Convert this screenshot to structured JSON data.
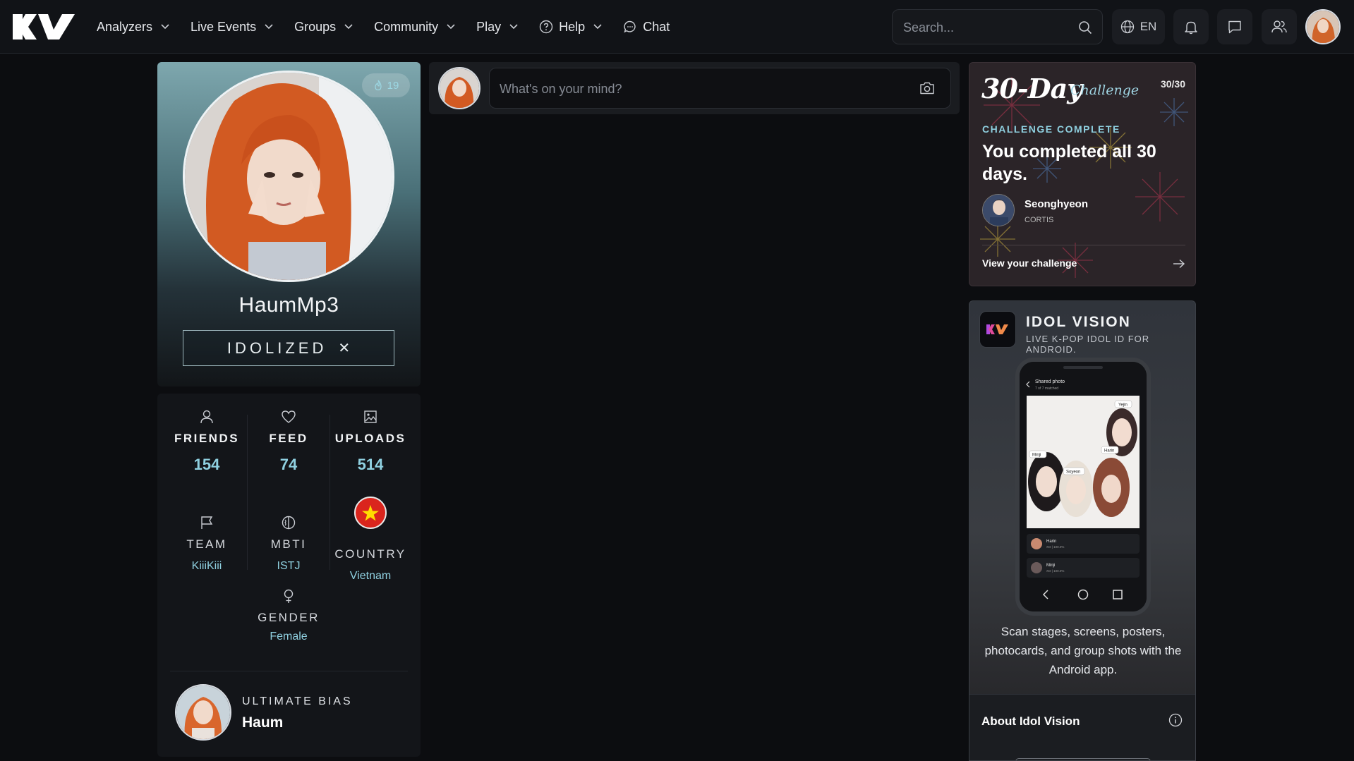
{
  "header": {
    "nav": [
      {
        "label": "Analyzers"
      },
      {
        "label": "Live Events"
      },
      {
        "label": "Groups"
      },
      {
        "label": "Community"
      },
      {
        "label": "Play"
      },
      {
        "label": "Help"
      },
      {
        "label": "Chat"
      }
    ],
    "search_placeholder": "Search...",
    "language": "EN"
  },
  "profile": {
    "badge_count": "19",
    "username": "HaumMp3",
    "idolized_label": "IDOLIZED",
    "idolized_close": "✕"
  },
  "stats": {
    "friends": {
      "label": "FRIENDS",
      "value": "154"
    },
    "feed": {
      "label": "FEED",
      "value": "74"
    },
    "uploads": {
      "label": "UPLOADS",
      "value": "514"
    },
    "team": {
      "label": "TEAM",
      "value": "KiiiKiii"
    },
    "mbti": {
      "label": "MBTI",
      "value": "ISTJ"
    },
    "country": {
      "label": "COUNTRY",
      "value": "Vietnam"
    },
    "gender": {
      "label": "GENDER",
      "value": "Female"
    },
    "bias_label": "ULTIMATE BIAS",
    "bias_name": "Haum"
  },
  "composer": {
    "placeholder": "What's on your mind?"
  },
  "challenge": {
    "title_main": "30-Day",
    "title_script": "Challenge",
    "count": "30/30",
    "status": "CHALLENGE COMPLETE",
    "message": "You completed all 30 days.",
    "user": "Seonghyeon",
    "group": "CORTIS",
    "link": "View your challenge"
  },
  "vision": {
    "title": "IDOL VISION",
    "subtitle": "LIVE K-POP IDOL ID FOR ANDROID.",
    "description": "Scan stages, screens, posters, photocards, and group shots with the Android app.",
    "about": "About Idol Vision",
    "phone": {
      "header": "Shared photo",
      "subheader": "7 of 7 matched",
      "tags": [
        "Yejin",
        "Minji",
        "Soyeon",
        "Harin"
      ],
      "list": [
        {
          "name": "Harin",
          "meta": "XO | 100.0%"
        },
        {
          "name": "Minji",
          "meta": "XO | 100.0%"
        }
      ]
    }
  },
  "colors": {
    "accent": "#8fd0e0",
    "background": "#0c0d10",
    "flag_red": "#da251d",
    "flag_star": "#ffdd00"
  }
}
